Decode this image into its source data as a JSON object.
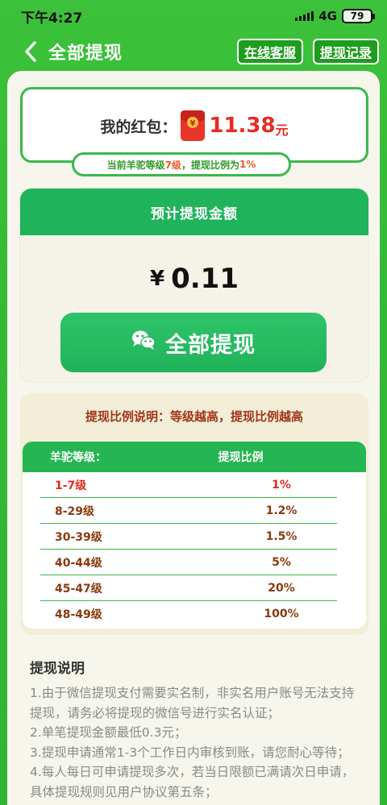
{
  "status": {
    "time": "下午4:27",
    "network": "4G",
    "battery": "79"
  },
  "nav": {
    "title": "全部提现",
    "service_label": "在线客服",
    "records_label": "提现记录"
  },
  "redpack": {
    "label": "我的红包：",
    "amount": "11.38",
    "unit": "元"
  },
  "level": {
    "prefix": "当前羊驼等级",
    "level": "7级",
    "middle": "，提现比例为",
    "ratio": "1%"
  },
  "estimate": {
    "title": "预计提现金额",
    "currency": "¥",
    "amount": "0.11",
    "button_label": "全部提现"
  },
  "ratio_table": {
    "title": "提现比例说明：等级越高，提现比例越高",
    "col_level": "羊驼等级：",
    "col_ratio": "提现比例",
    "rows": [
      {
        "level": "1-7级",
        "ratio": "1%"
      },
      {
        "level": "8-29级",
        "ratio": "1.2%"
      },
      {
        "level": "30-39级",
        "ratio": "1.5%"
      },
      {
        "level": "40-44级",
        "ratio": "5%"
      },
      {
        "level": "45-47级",
        "ratio": "20%"
      },
      {
        "level": "48-49级",
        "ratio": "100%"
      }
    ]
  },
  "description": {
    "title": "提现说明",
    "items": [
      "1.由于微信提现支付需要实名制，非实名用户账号无法支持提现，请务必将提现的微信号进行实名认证；",
      "2.单笔提现金额最低0.3元；",
      "3.提现申请通常1-3个工作日内审核到账，请您耐心等待；",
      "4.每人每日可申请提现多次，若当日限额已满请次日申请，具体提现规则见用户协议第五条；"
    ]
  },
  "colors": {
    "brand_green": "#34b935",
    "accent_green": "#1fb35c",
    "red": "#e92b24",
    "brown": "#8b3a10"
  }
}
